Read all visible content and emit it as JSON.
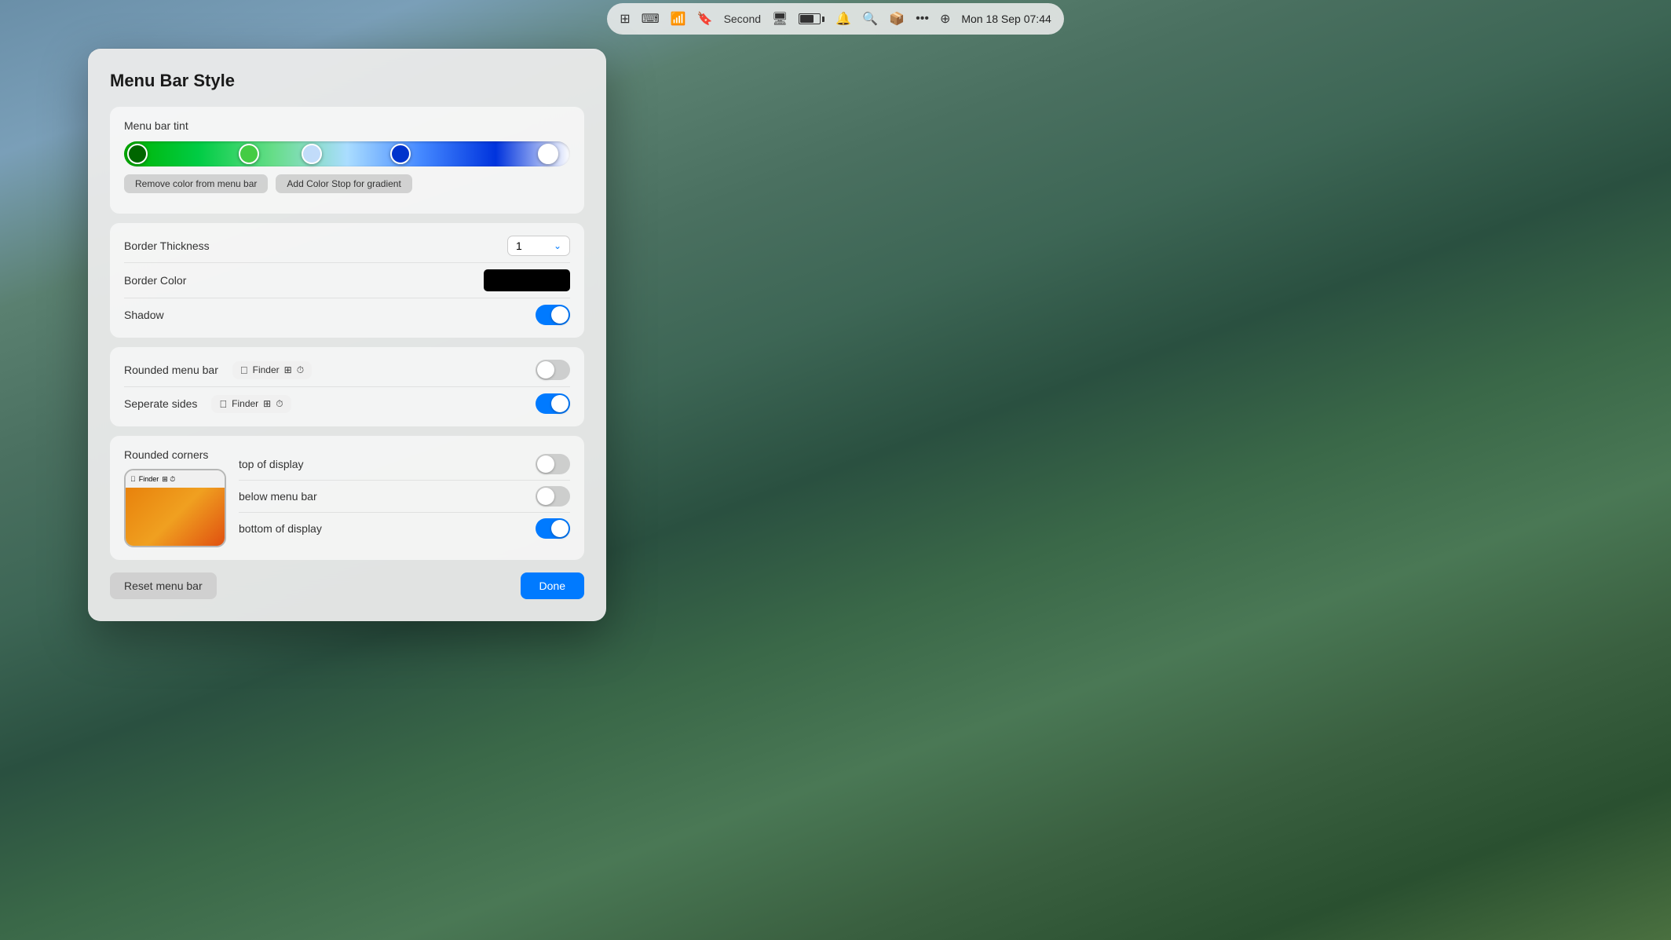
{
  "menubar": {
    "time": "Mon 18 Sep  07:44",
    "second_label": "Second"
  },
  "dialog": {
    "title": "Menu Bar Style",
    "sections": {
      "tint": {
        "label": "Menu bar tint",
        "remove_btn": "Remove color from menu bar",
        "add_btn": "Add Color Stop for gradient"
      },
      "border": {
        "thickness_label": "Border Thickness",
        "thickness_value": "1",
        "color_label": "Border Color",
        "shadow_label": "Shadow",
        "shadow_on": true
      },
      "rounded_menubar": {
        "rounded_label": "Rounded menu bar",
        "rounded_on": false,
        "separate_label": "Seperate sides",
        "separate_on": true,
        "preview_apple": "",
        "preview_finder": "Finder"
      },
      "rounded_corners": {
        "label": "Rounded corners",
        "top_label": "top of display",
        "top_on": false,
        "below_label": "below menu bar",
        "below_on": false,
        "bottom_label": "bottom of display",
        "bottom_on": true
      }
    },
    "footer": {
      "reset_label": "Reset menu bar",
      "done_label": "Done"
    }
  }
}
